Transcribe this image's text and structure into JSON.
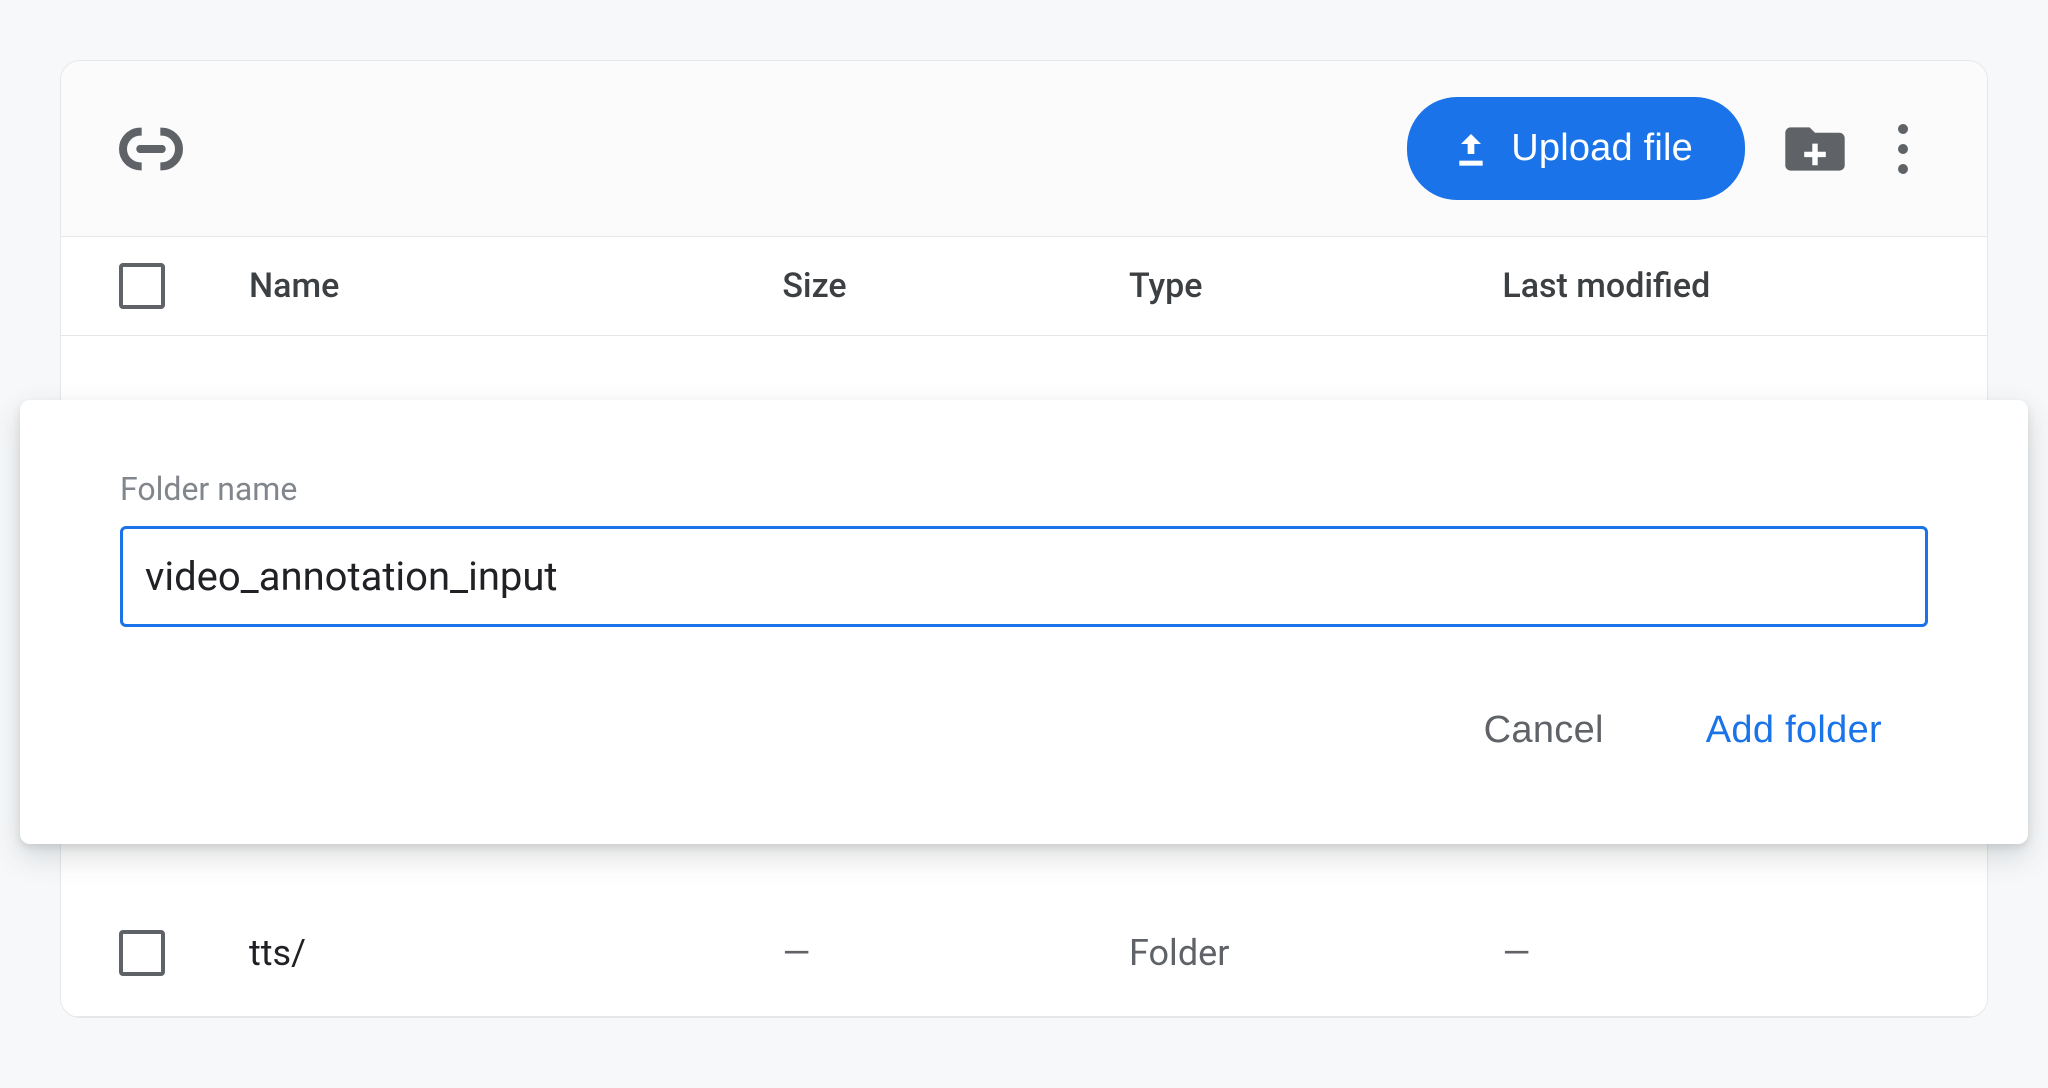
{
  "toolbar": {
    "upload_label": "Upload file"
  },
  "columns": {
    "name": "Name",
    "size": "Size",
    "type": "Type",
    "last_modified": "Last modified"
  },
  "dialog": {
    "label": "Folder name",
    "value": "video_annotation_input",
    "cancel_label": "Cancel",
    "confirm_label": "Add folder"
  },
  "rows": [
    {
      "name": "tts/",
      "size": "—",
      "type": "Folder",
      "last_modified": "—"
    }
  ]
}
